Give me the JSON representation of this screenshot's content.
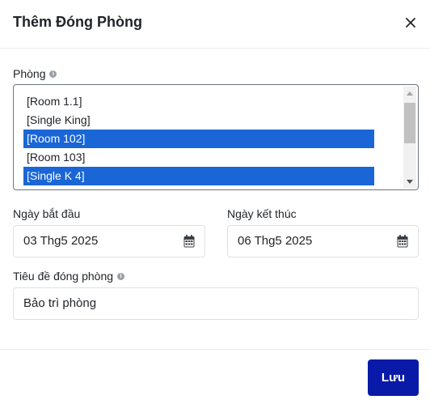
{
  "header": {
    "title": "Thêm Đóng Phòng"
  },
  "room_field": {
    "label": "Phòng",
    "options": [
      {
        "text": "[Room 1.1]",
        "selected": false
      },
      {
        "text": "[Single King]",
        "selected": false
      },
      {
        "text": "[Room 102]",
        "selected": true
      },
      {
        "text": "[Room 103]",
        "selected": false
      },
      {
        "text": "[Single K 4]",
        "selected": true
      }
    ]
  },
  "start_date": {
    "label": "Ngày bắt đầu",
    "value": "03 Thg5 2025"
  },
  "end_date": {
    "label": "Ngày kết thúc",
    "value": "06 Thg5 2025"
  },
  "closure_title": {
    "label": "Tiêu đề đóng phòng",
    "value": "Bảo trì phòng"
  },
  "footer": {
    "save_label": "Lưu"
  },
  "colors": {
    "selection": "#1a66d6",
    "primary_button": "#0a1aa8"
  }
}
